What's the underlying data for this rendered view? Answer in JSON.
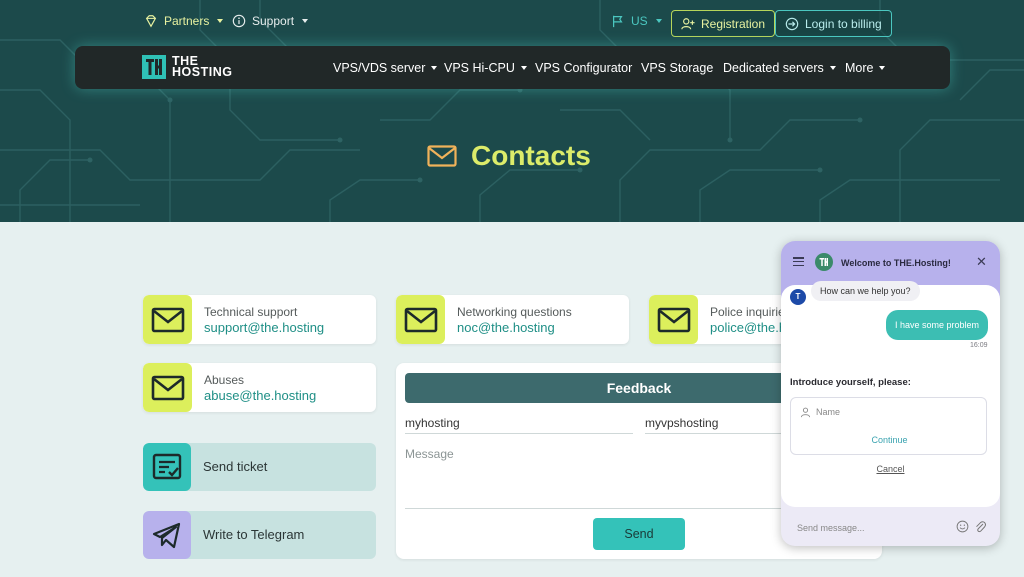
{
  "topbar": {
    "partners": "Partners",
    "support": "Support",
    "language": "US",
    "registration": "Registration",
    "login": "Login to billing"
  },
  "logo": {
    "line1": "THE",
    "line2": "HOSTING"
  },
  "nav": {
    "items": [
      {
        "label": "VPS/VDS server",
        "dropdown": true
      },
      {
        "label": "VPS Hi-CPU",
        "dropdown": true
      },
      {
        "label": "VPS Configurator",
        "dropdown": false
      },
      {
        "label": "VPS Storage",
        "dropdown": false
      },
      {
        "label": "Dedicated servers",
        "dropdown": true
      },
      {
        "label": "More",
        "dropdown": true
      }
    ]
  },
  "hero": {
    "title": "Contacts",
    "icon": "envelope-icon"
  },
  "contacts": [
    {
      "label": "Technical support",
      "email": "support@the.hosting"
    },
    {
      "label": "Networking questions",
      "email": "noc@the.hosting"
    },
    {
      "label": "Police inquiries",
      "email": "police@the.hosting"
    },
    {
      "label": "Abuses",
      "email": "abuse@the.hosting"
    }
  ],
  "actions": {
    "ticket": "Send ticket",
    "telegram": "Write to Telegram"
  },
  "feedback": {
    "title": "Feedback",
    "field1_value": "myhosting",
    "field2_value": "myvpshosting",
    "message_placeholder": "Message",
    "send": "Send"
  },
  "chat": {
    "title": "Welcome to THE.Hosting!",
    "bot_message": "How can we help you?",
    "user_message": "I have some problem",
    "time": "16:09",
    "intro": "Introduce yourself, please:",
    "name_placeholder": "Name",
    "continue": "Continue",
    "cancel": "Cancel",
    "input_placeholder": "Send message..."
  },
  "colors": {
    "hero_bg": "#1c4a4b",
    "accent_lime": "#dcef5c",
    "accent_teal": "#34c2b9",
    "chat_header": "#b7b1ec"
  }
}
